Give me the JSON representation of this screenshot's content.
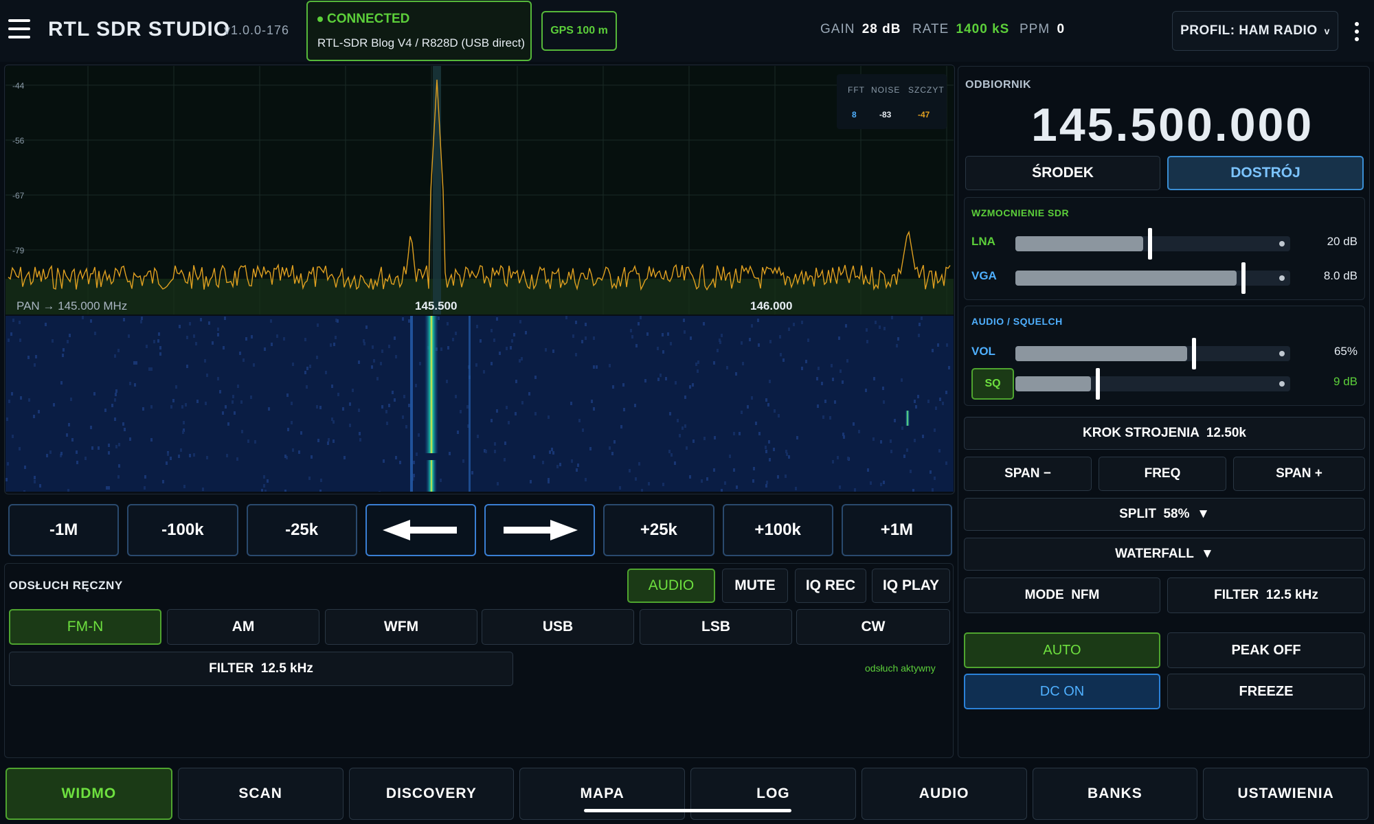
{
  "header": {
    "app_title": "RTL SDR STUDIO",
    "version": "v1.0.0-176",
    "connection_status": "CONNECTED",
    "device": "RTL-SDR Blog V4 / R828D (USB direct)",
    "gps": "GPS 100 m",
    "gain_label": "GAIN",
    "gain_value": "28 dB",
    "rate_label": "RATE",
    "rate_value": "1400 kS",
    "ppm_label": "PPM",
    "ppm_value": "0",
    "profile": "PROFIL: HAM RADIO"
  },
  "spectrum": {
    "db_ticks": [
      "-44",
      "-56",
      "-67",
      "-79"
    ],
    "stats": {
      "fft_label": "FFT",
      "fft_value": "8",
      "noise_label": "NOISE",
      "noise_value": "-83",
      "peak_label": "SZCZYT",
      "peak_value": "-47"
    },
    "pan_text": "PAN → 145.000 MHz",
    "freq_labels": [
      "145.500",
      "146.000"
    ]
  },
  "step_buttons": [
    "-1M",
    "-100k",
    "-25k",
    "+25k",
    "+100k",
    "+1M"
  ],
  "listen": {
    "title": "ODSŁUCH RĘCZNY",
    "actions": [
      "AUDIO",
      "MUTE",
      "IQ REC",
      "IQ PLAY"
    ],
    "modes": [
      "FM-N",
      "AM",
      "WFM",
      "USB",
      "LSB",
      "CW"
    ],
    "filter": "FILTER  12.5 kHz",
    "status": "odsłuch aktywny"
  },
  "receiver": {
    "title": "ODBIORNIK",
    "frequency": "145.500.000",
    "center_btn": "ŚRODEK",
    "tune_btn": "DOSTRÓJ",
    "gain_title": "WZMOCNIENIE SDR",
    "lna_label": "LNA",
    "lna_value": "20 dB",
    "lna_level": 0.49,
    "vga_label": "VGA",
    "vga_value": "8.0 dB",
    "vga_level": 0.83,
    "audio_title": "AUDIO / SQUELCH",
    "vol_label": "VOL",
    "vol_value": "65%",
    "vol_level": 0.65,
    "sq_label": "SQ",
    "sq_value": "9 dB",
    "sq_level": 0.3,
    "step": "KROK STROJENIA  12.50k",
    "span_minus": "SPAN −",
    "freq": "FREQ",
    "span_plus": "SPAN +",
    "split": "SPLIT  58%  ▼",
    "waterfall": "WATERFALL  ▼",
    "mode": "MODE  NFM",
    "filter": "FILTER  12.5 kHz",
    "auto": "AUTO",
    "peak": "PEAK OFF",
    "dc": "DC ON",
    "freeze": "FREEZE"
  },
  "tabs": [
    "WIDMO",
    "SCAN",
    "DISCOVERY",
    "MAPA",
    "LOG",
    "AUDIO",
    "BANKS",
    "USTAWIENIA"
  ],
  "colors": {
    "accent_green": "#5ccf3a",
    "accent_blue": "#4fb0ff",
    "trace": "#e0a020"
  }
}
